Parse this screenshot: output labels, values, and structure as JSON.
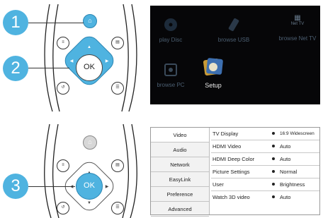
{
  "steps": [
    {
      "number": "1"
    },
    {
      "number": "2"
    },
    {
      "number": "3"
    }
  ],
  "remote": {
    "ok_label": "OK"
  },
  "home_screen": {
    "items": [
      {
        "label": "play Disc",
        "icon": "disc-icon"
      },
      {
        "label": "browse USB",
        "icon": "usb-icon"
      },
      {
        "label": "browse Net TV",
        "icon": "net-tv-icon",
        "icon_text": "Net TV"
      },
      {
        "label": "browse PC",
        "icon": "pc-icon"
      },
      {
        "label": "Setup",
        "icon": "setup-icon"
      }
    ]
  },
  "settings_menu": {
    "categories": [
      "Video",
      "Audio",
      "Network",
      "EasyLink",
      "Preference",
      "Advanced"
    ],
    "active_category": "Video",
    "rows": [
      {
        "setting": "TV Display",
        "value": "16:9 Widescreen"
      },
      {
        "setting": "HDMI Video",
        "value": "Auto"
      },
      {
        "setting": "HDMI Deep Color",
        "value": "Auto"
      },
      {
        "setting": "Picture Settings",
        "value": "Normal"
      },
      {
        "setting": "User",
        "value": "Brightness"
      },
      {
        "setting": "Watch 3D video",
        "value": "Auto"
      }
    ]
  },
  "colors": {
    "accent": "#4fb3e0",
    "screen_bg": "#060608"
  }
}
